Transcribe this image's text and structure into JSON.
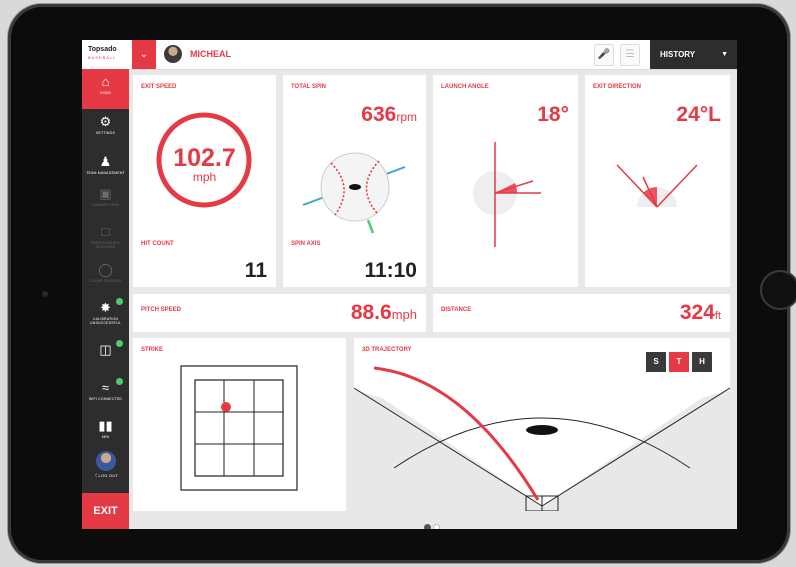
{
  "app": {
    "logo_main": "Topsado",
    "logo_sub": "BASEBALL"
  },
  "topbar": {
    "username": "MICHEAL",
    "history_label": "HISTORY"
  },
  "sidebar": {
    "items": [
      {
        "label": "HOME"
      },
      {
        "label": "SETTINGS"
      },
      {
        "label": "TEAM MANAGEMENT"
      },
      {
        "label": "CHANGE VIEW"
      },
      {
        "label": "PARTICIPATION SESSIONS"
      },
      {
        "label": "CLEAR SESSION"
      },
      {
        "label": "CALIBRATION UNSUCCESSFUL"
      },
      {
        "label": ""
      },
      {
        "label": "WIFI CONNECTED"
      },
      {
        "label": "68%"
      },
      {
        "label": "LOG OUT"
      }
    ],
    "exit_label": "EXIT"
  },
  "metrics": {
    "exit_speed": {
      "title": "EXIT SPEED",
      "value": "102.7",
      "unit": "mph"
    },
    "hit_count": {
      "title": "HIT COUNT",
      "value": "11"
    },
    "total_spin": {
      "title": "TOTAL SPIN",
      "value": "636",
      "unit": "rpm"
    },
    "spin_axis": {
      "title": "SPIN AXIS",
      "value": "11:10"
    },
    "launch_angle": {
      "title": "LAUNCH ANGLE",
      "value": "18°"
    },
    "exit_direction": {
      "title": "EXIT DIRECTION",
      "value": "24°L"
    },
    "pitch_speed": {
      "title": "PITCH SPEED",
      "value": "88.6",
      "unit": "mph"
    },
    "distance": {
      "title": "DISTANCE",
      "value": "324",
      "unit": "ft"
    },
    "strike": {
      "title": "STRIKE"
    },
    "trajectory": {
      "title": "3D TRAJECTORY",
      "views": [
        "S",
        "T",
        "H"
      ],
      "active_view": "T"
    }
  },
  "pager": {
    "pages": 2,
    "current": 1
  },
  "colors": {
    "accent": "#e63946",
    "dark": "#2d2d2d",
    "ok": "#4ecb71"
  },
  "icons": [
    "home-icon",
    "gear-icon",
    "team-icon",
    "camera-icon",
    "session-icon",
    "clear-icon",
    "calibration-icon",
    "device-icon",
    "wifi-icon",
    "battery-icon",
    "logout-icon",
    "microphone-icon",
    "notes-icon"
  ]
}
